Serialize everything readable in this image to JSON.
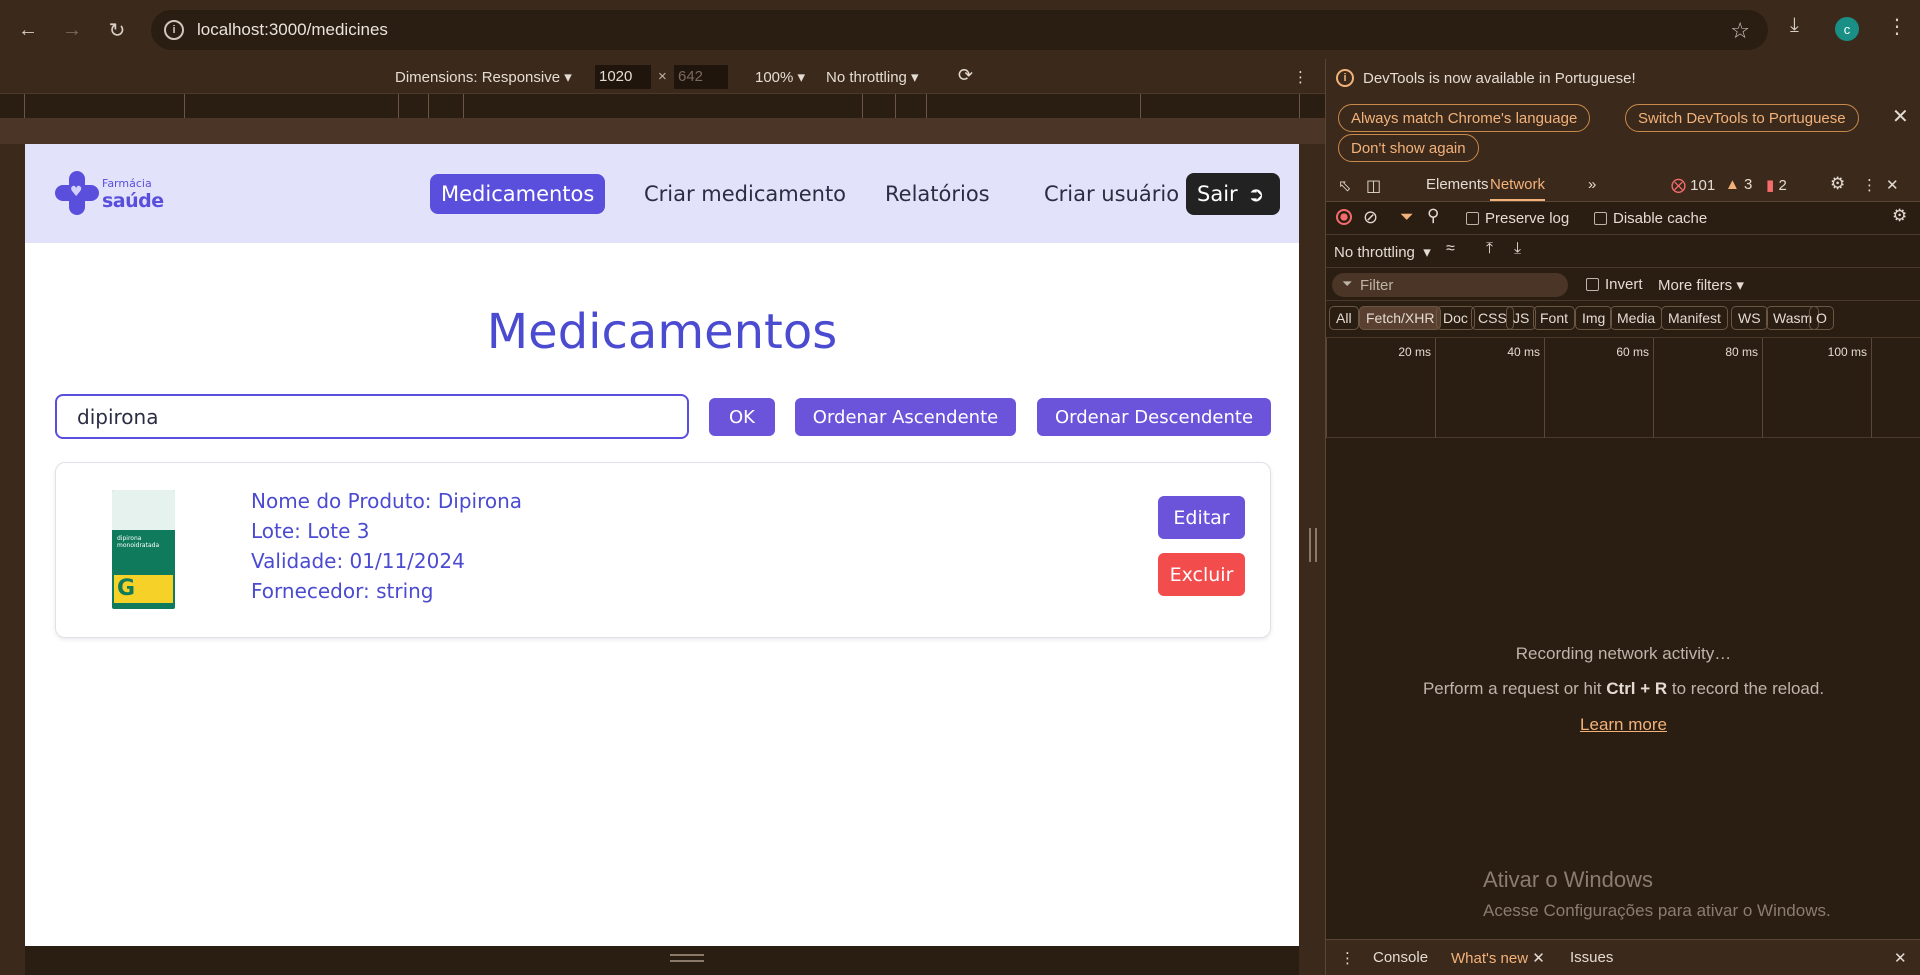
{
  "browser": {
    "url": "localhost:3000/medicines",
    "avatar_letter": "c"
  },
  "device_toolbar": {
    "dimensions_label": "Dimensions: Responsive",
    "width": "1020",
    "times": "×",
    "height": "642",
    "zoom": "100%",
    "throttling": "No throttling"
  },
  "app": {
    "logo": {
      "line1": "Farmácia",
      "line2": "saúde"
    },
    "nav": {
      "medicines": "Medicamentos",
      "create_medicine": "Criar medicamento",
      "reports": "Relatórios",
      "create_user": "Criar usuário",
      "logout": "Sair"
    },
    "page_title": "Medicamentos",
    "search": {
      "value": "dipirona"
    },
    "buttons": {
      "ok": "OK",
      "sort_asc": "Ordenar Ascendente",
      "sort_desc": "Ordenar Descendente"
    },
    "product": {
      "name": "Nome do Produto: Dipirona",
      "lot": "Lote: Lote 3",
      "expiry": "Validade: 01/11/2024",
      "supplier": "Fornecedor: string",
      "edit_label": "Editar",
      "delete_label": "Excluir",
      "image_text": "dipirona monoidratada",
      "image_badge": "G"
    }
  },
  "devtools": {
    "info_message": "DevTools is now available in Portuguese!",
    "btn_match": "Always match Chrome's language",
    "btn_switch": "Switch DevTools to Portuguese",
    "btn_dont_show": "Don't show again",
    "tabs": {
      "elements": "Elements",
      "network": "Network"
    },
    "counts": {
      "errors": "101",
      "warnings": "3",
      "issues": "2"
    },
    "preserve_log": "Preserve log",
    "disable_cache": "Disable cache",
    "throttling": "No throttling",
    "filter_placeholder": "Filter",
    "invert": "Invert",
    "more_filters": "More filters",
    "filter_types": [
      "All",
      "Fetch/XHR",
      "Doc",
      "CSS",
      "JS",
      "Font",
      "Img",
      "Media",
      "Manifest",
      "WS",
      "Wasm",
      "O"
    ],
    "timeline_labels": [
      "20 ms",
      "40 ms",
      "60 ms",
      "80 ms",
      "100 ms"
    ],
    "recording": "Recording network activity…",
    "perform_prefix": "Perform a request or hit ",
    "perform_shortcut": "Ctrl + R",
    "perform_suffix": " to record the reload.",
    "learn_more": "Learn more",
    "watermark_title": "Ativar o Windows",
    "watermark_sub": "Acesse Configurações para ativar o Windows.",
    "drawer": {
      "console": "Console",
      "whats_new": "What's new",
      "issues": "Issues"
    }
  },
  "colors": {
    "brand": "#5a4fdc",
    "danger": "#f24c4c",
    "chrome_bg": "#3b2a1c"
  }
}
